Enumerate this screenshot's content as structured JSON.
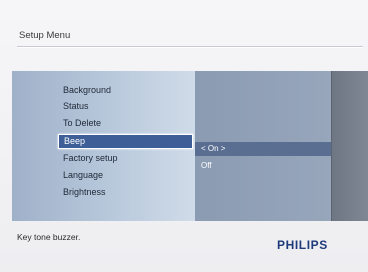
{
  "header": {
    "title": "Setup Menu"
  },
  "menu": {
    "items": [
      {
        "label": "Background"
      },
      {
        "label": "Status"
      },
      {
        "label": "To Delete"
      },
      {
        "label": "Beep",
        "selected": true
      },
      {
        "label": "Factory setup"
      },
      {
        "label": "Language"
      },
      {
        "label": "Brightness"
      }
    ]
  },
  "submenu": {
    "options": [
      {
        "label": "< On >",
        "selected": true
      },
      {
        "label": "Off"
      }
    ]
  },
  "footer": {
    "help_text": "Key tone buzzer.",
    "brand": "PHILIPS"
  },
  "colors": {
    "selection": "#3d5e97",
    "brand": "#1f3a7a"
  }
}
